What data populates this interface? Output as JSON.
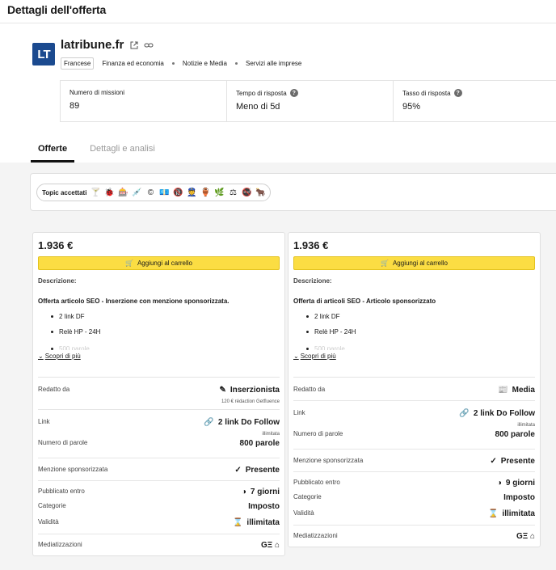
{
  "page": {
    "title": "Dettagli dell'offerta"
  },
  "site": {
    "logo": "LT",
    "name": "latribune.fr",
    "language": "Francese",
    "categories": [
      "Finanza ed economia",
      "Notizie e Media",
      "Servizi alle imprese"
    ]
  },
  "stats": [
    {
      "label": "Numero di missioni",
      "value": "89"
    },
    {
      "label": "Tempo di risposta",
      "value": "Meno di 5d"
    },
    {
      "label": "Tasso di risposta",
      "value": "95%"
    }
  ],
  "tabs": [
    {
      "label": "Offerte"
    },
    {
      "label": "Dettagli e analisi"
    }
  ],
  "topics": {
    "label": "Topic accettati",
    "icons": [
      "🍸",
      "🐞",
      "🎰",
      "💉",
      "©",
      "💶",
      "🔞",
      "👮",
      "🏺",
      "🌿",
      "⚖",
      "🚭",
      "🐂"
    ]
  },
  "cards": [
    {
      "price": "1.936 €",
      "cart": "Aggiungi al carrello",
      "desc_label": "Descrizione:",
      "offer": "Offerta articolo SEO - Inserzione con menzione sponsorizzata.",
      "bullets": [
        "2 link DF",
        "Relè HP - 24H",
        "500 parole"
      ],
      "more": "Scopri di più",
      "rows": [
        {
          "k": "Redatto da",
          "icon": "✎",
          "v": "Inserzionista",
          "sub": "120 € rédaction Getfluence"
        },
        {
          "k": "Link",
          "icon": "🔗",
          "v": "2 link Do Follow",
          "sub": "illimitata"
        },
        {
          "k": "Numero di parole",
          "icon": "",
          "v": "800 parole",
          "sub": ""
        },
        {
          "k": "Menzione sponsorizzata",
          "icon": "✓",
          "v": "Presente",
          "sub": ""
        },
        {
          "k": "Pubblicato entro",
          "icon": "◑",
          "v": "7 giorni",
          "sub": ""
        },
        {
          "k": "Categorie",
          "icon": "",
          "v": "Imposto",
          "sub": ""
        },
        {
          "k": "Validità",
          "icon": "⌛",
          "v": "illimitata",
          "sub": ""
        },
        {
          "k": "Mediatizzazioni",
          "icon": "",
          "v": "GΞ ⌂",
          "sub": ""
        }
      ]
    },
    {
      "price": "1.936 €",
      "cart": "Aggiungi al carrello",
      "desc_label": "Descrizione:",
      "offer": "Offerta di articoli SEO - Articolo sponsorizzato",
      "bullets": [
        "2 link DF",
        "Relè HP - 24H",
        "500 parole"
      ],
      "more": "Scopri di più",
      "rows": [
        {
          "k": "Redatto da",
          "icon": "📰",
          "v": "Media",
          "sub": ""
        },
        {
          "k": "Link",
          "icon": "🔗",
          "v": "2 link Do Follow",
          "sub": "illimitata"
        },
        {
          "k": "Numero di parole",
          "icon": "",
          "v": "800 parole",
          "sub": ""
        },
        {
          "k": "Menzione sponsorizzata",
          "icon": "✓",
          "v": "Presente",
          "sub": ""
        },
        {
          "k": "Pubblicato entro",
          "icon": "◑",
          "v": "9 giorni",
          "sub": ""
        },
        {
          "k": "Categorie",
          "icon": "",
          "v": "Imposto",
          "sub": ""
        },
        {
          "k": "Validità",
          "icon": "⌛",
          "v": "illimitata",
          "sub": ""
        },
        {
          "k": "Mediatizzazioni",
          "icon": "",
          "v": "GΞ ⌂",
          "sub": ""
        }
      ]
    }
  ]
}
